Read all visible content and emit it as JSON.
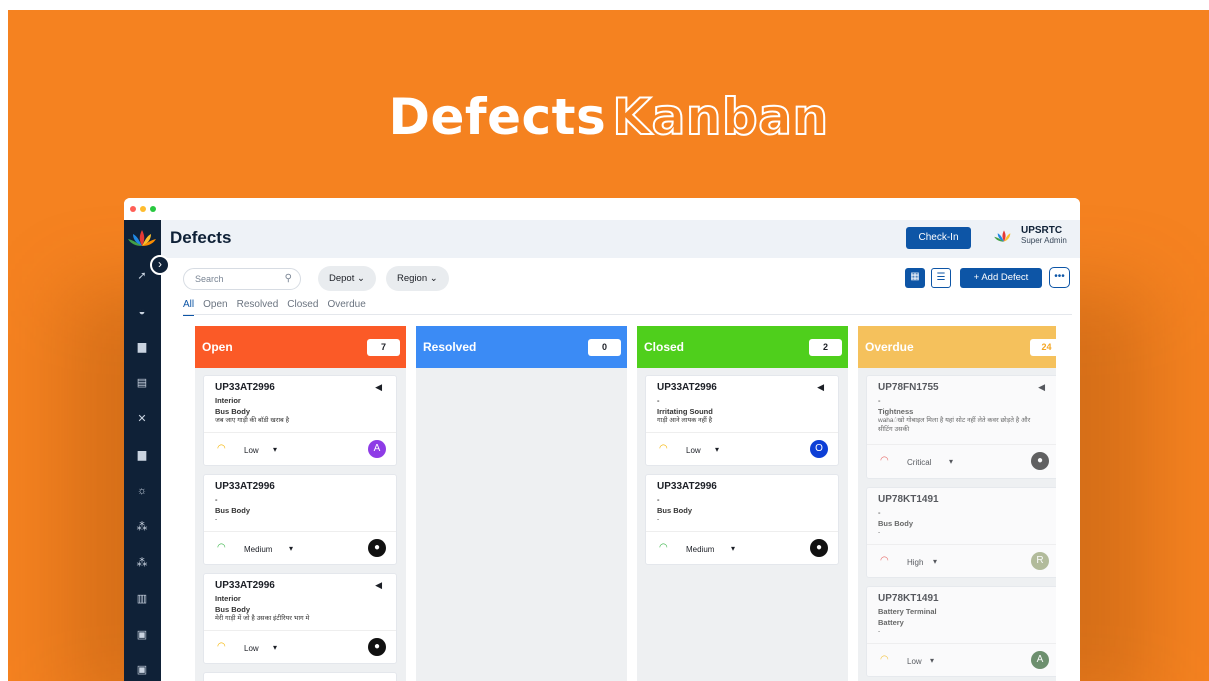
{
  "hero": {
    "title_a": "Defects",
    "title_b": "Kanban"
  },
  "colors": {
    "background": "#f58220",
    "accent": "#0d55a6",
    "sidebar": "#0f2137",
    "open": "#fb5a27",
    "resolved": "#3b8bf5",
    "closed": "#4fcf1c",
    "overdue": "#f5c15c"
  },
  "header": {
    "title": "Defects",
    "checkin_label": "Check-In",
    "org_name": "UPSRTC",
    "role": "Super Admin"
  },
  "toolbar": {
    "search_placeholder": "Search",
    "depot_label": "Depot",
    "region_label": "Region",
    "add_label": "+ Add Defect"
  },
  "tabs": [
    "All",
    "Open",
    "Resolved",
    "Closed",
    "Overdue"
  ],
  "columns": [
    {
      "title": "Open",
      "count": "7",
      "cards": [
        {
          "id": "UP33AT2996",
          "line1": "Interior",
          "line2": "Bus Body",
          "desc": "जब जाए गाड़ी की बॉडी खराब है",
          "priority": "Low",
          "avatar": "A",
          "speaker": true
        },
        {
          "id": "UP33AT2996",
          "line1": "-",
          "line2": "Bus Body",
          "desc": "-",
          "priority": "Medium",
          "avatar": "",
          "speaker": false
        },
        {
          "id": "UP33AT2996",
          "line1": "Interior",
          "line2": "Bus Body",
          "desc": "मेरी गाड़ी में जो है उसका इंटीरियर भाग मे",
          "priority": "Low",
          "avatar": "",
          "speaker": true
        }
      ]
    },
    {
      "title": "Resolved",
      "count": "0",
      "cards": []
    },
    {
      "title": "Closed",
      "count": "2",
      "cards": [
        {
          "id": "UP33AT2996",
          "line1": "-",
          "line2": "Irritating Sound",
          "desc": "गाड़ी आने लायक नहीं है",
          "priority": "Low",
          "avatar": "O",
          "speaker": true
        },
        {
          "id": "UP33AT2996",
          "line1": "-",
          "line2": "Bus Body",
          "desc": "-",
          "priority": "Medium",
          "avatar": "",
          "speaker": false
        }
      ]
    },
    {
      "title": "Overdue",
      "count": "24",
      "cards": [
        {
          "id": "UP78FN1755",
          "line1": "-",
          "line2": "Tightness",
          "desc": "wahaंखो गोबाइल मिला है यहां सोट नहीं लेते कवर छोड़ते है और",
          "desc2": "सीटिंग उसकी",
          "priority": "Critical",
          "avatar": "",
          "speaker": true
        },
        {
          "id": "UP78KT1491",
          "line1": "-",
          "line2": "Bus Body",
          "desc": "-",
          "priority": "High",
          "avatar": "R",
          "speaker": false
        },
        {
          "id": "UP78KT1491",
          "line1": "Battery Terminal",
          "line2": "Battery",
          "desc": "-",
          "priority": "Low",
          "avatar": "A",
          "speaker": false
        }
      ]
    }
  ]
}
